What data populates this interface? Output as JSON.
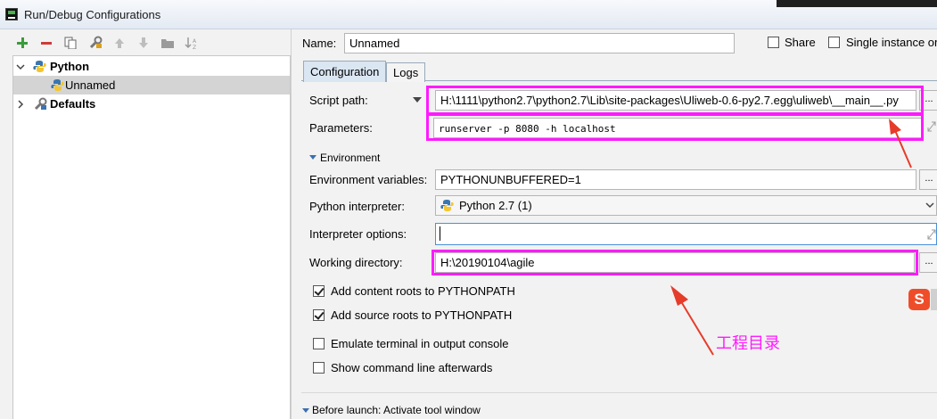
{
  "window": {
    "title": "Run/Debug Configurations"
  },
  "toolbar": {
    "icons": [
      "add-icon",
      "remove-icon",
      "copy-icon",
      "wrench-icon",
      "move-up-icon",
      "move-down-icon",
      "folder-icon",
      "sort-icon"
    ]
  },
  "tree": {
    "python_label": "Python",
    "unnamed_label": "Unnamed",
    "defaults_label": "Defaults"
  },
  "form": {
    "name_label": "Name:",
    "name_value": "Unnamed",
    "share_label": "Share",
    "single_instance_label": "Single instance or",
    "tab_configuration": "Configuration",
    "tab_logs": "Logs",
    "script_path_label": "Script path:",
    "script_path_value": "H:\\1111\\python2.7\\python2.7\\Lib\\site-packages\\Uliweb-0.6-py2.7.egg\\uliweb\\__main__.py",
    "parameters_label": "Parameters:",
    "parameters_value": "runserver -p 8080 -h localhost",
    "environment_section": "Environment",
    "env_vars_label": "Environment variables:",
    "env_vars_value": "PYTHONUNBUFFERED=1",
    "interpreter_label": "Python interpreter:",
    "interpreter_value": "Python 2.7 (1)",
    "interpreter_options_label": "Interpreter options:",
    "interpreter_options_value": "",
    "working_dir_label": "Working directory:",
    "working_dir_value": "H:\\20190104\\agile",
    "add_content_roots_label": "Add content roots to PYTHONPATH",
    "add_source_roots_label": "Add source roots to PYTHONPATH",
    "emulate_terminal_label": "Emulate terminal in output console",
    "show_command_line_label": "Show command line afterwards",
    "before_launch_label": "Before launch: Activate tool window",
    "ellipsis": "..."
  },
  "checkboxes": {
    "share": false,
    "single_instance": false,
    "add_content_roots": true,
    "add_source_roots": true,
    "emulate_terminal": false,
    "show_command_line": false
  },
  "annotation": {
    "text": "工程目录",
    "color": "#ff1aff"
  },
  "colors": {
    "highlight": "#ff1aff",
    "arrow": "#e63c2a"
  }
}
